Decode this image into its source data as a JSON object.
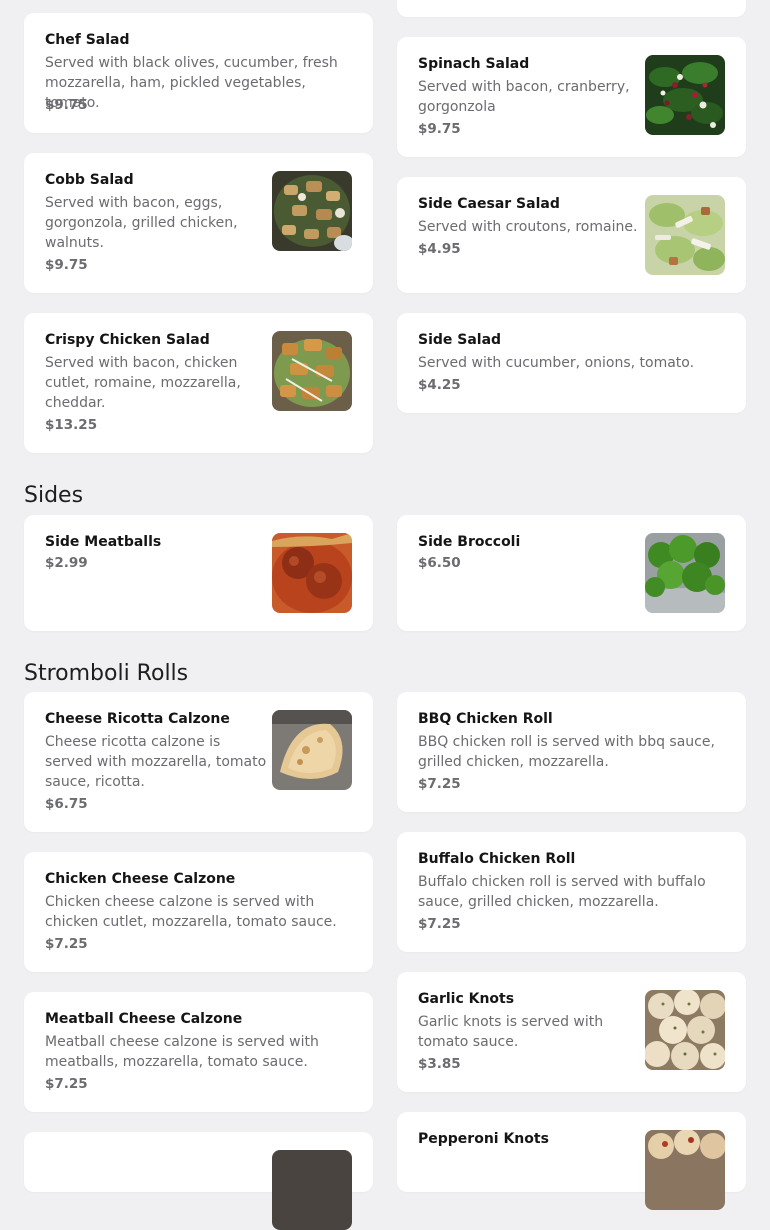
{
  "items": {
    "chef_salad": {
      "name": "Chef Salad",
      "desc": "Served with black olives, cucumber, fresh mozzarella, ham, pickled vegetables, tomato.",
      "price": "$9.75"
    },
    "spinach_salad": {
      "name": "Spinach Salad",
      "desc": "Served with bacon, cranberry, gorgonzola",
      "price": "$9.75",
      "image": "spinach-salad-photo"
    },
    "cobb_salad": {
      "name": "Cobb Salad",
      "desc": "Served with bacon, eggs, gorgonzola, grilled chicken, walnuts.",
      "price": "$9.75",
      "image": "cobb-salad-photo"
    },
    "side_caesar_salad": {
      "name": "Side Caesar Salad",
      "desc": "Served with croutons, romaine.",
      "price": "$4.95",
      "image": "caesar-salad-photo"
    },
    "crispy_chicken_salad": {
      "name": "Crispy Chicken Salad",
      "desc": "Served with bacon, chicken cutlet, romaine, mozzarella, cheddar.",
      "price": "$13.25",
      "image": "crispy-chicken-salad-photo"
    },
    "side_salad": {
      "name": "Side Salad",
      "desc": "Served with cucumber, onions, tomato.",
      "price": "$4.25"
    },
    "side_meatballs": {
      "name": "Side Meatballs",
      "price": "$2.99",
      "image": "meatballs-photo"
    },
    "side_broccoli": {
      "name": "Side Broccoli",
      "price": "$6.50",
      "image": "broccoli-photo"
    },
    "cheese_ricotta_calzone": {
      "name": "Cheese Ricotta Calzone",
      "desc": "Cheese ricotta calzone is served with mozzarella, tomato sauce, ricotta.",
      "price": "$6.75",
      "image": "calzone-photo"
    },
    "bbq_chicken_roll": {
      "name": "BBQ Chicken Roll",
      "desc": "BBQ chicken roll is served with bbq sauce, grilled chicken, mozzarella.",
      "price": "$7.25"
    },
    "chicken_cheese_calzone": {
      "name": "Chicken Cheese Calzone",
      "desc": "Chicken cheese calzone is served with chicken cutlet, mozzarella, tomato sauce.",
      "price": "$7.25"
    },
    "buffalo_chicken_roll": {
      "name": "Buffalo Chicken Roll",
      "desc": "Buffalo chicken roll is served with buffalo sauce, grilled chicken, mozzarella.",
      "price": "$7.25"
    },
    "meatball_cheese_calzone": {
      "name": "Meatball Cheese Calzone",
      "desc": "Meatball cheese calzone is served with meatballs, mozzarella, tomato sauce.",
      "price": "$7.25"
    },
    "garlic_knots": {
      "name": "Garlic Knots",
      "desc": "Garlic knots is served with tomato sauce.",
      "price": "$3.85",
      "image": "garlic-knots-photo"
    },
    "pepperoni_knots": {
      "name": "Pepperoni Knots",
      "image": "pepperoni-knots-photo"
    }
  },
  "sections": {
    "sides": "Sides",
    "stromboli": "Stromboli Rolls"
  }
}
